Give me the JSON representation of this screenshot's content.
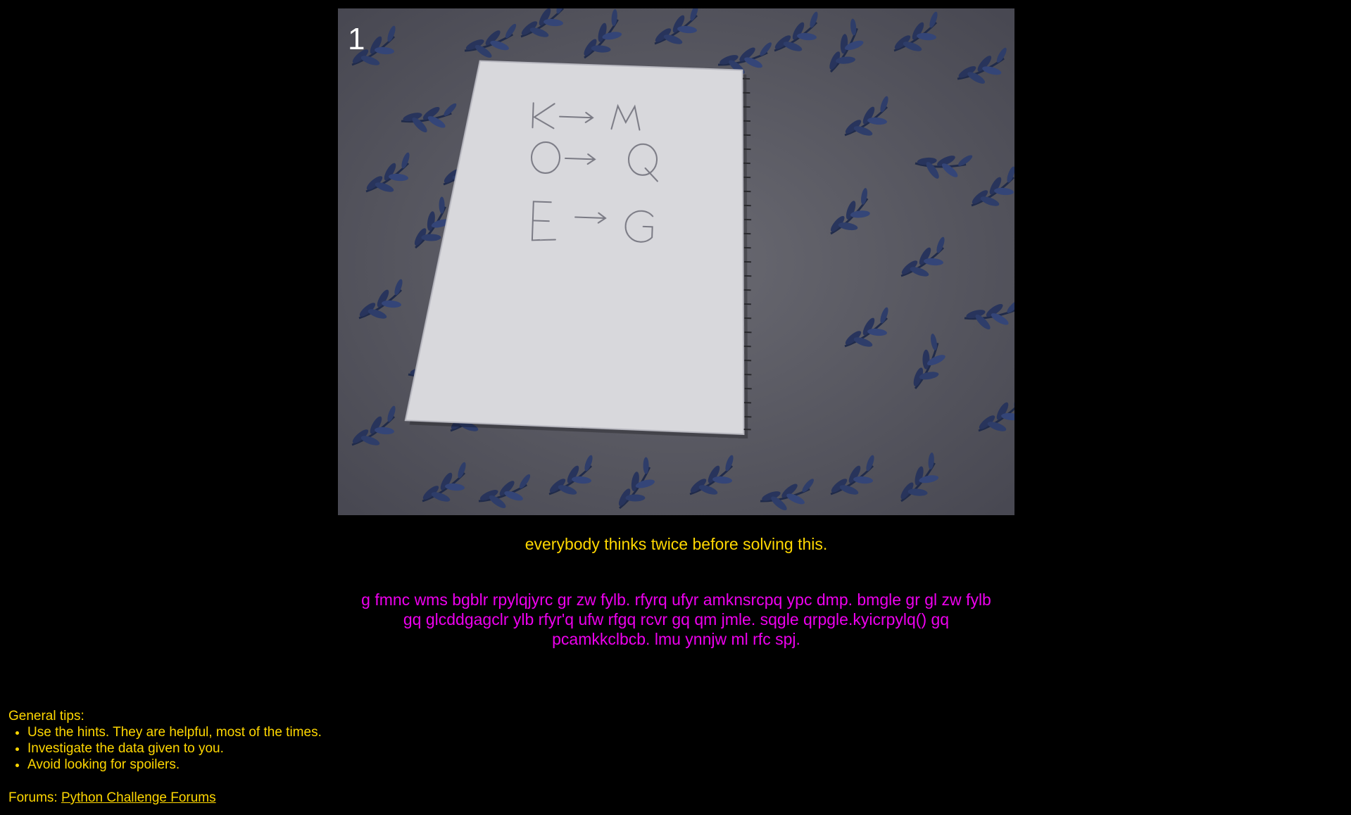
{
  "image": {
    "number_label": "1",
    "notebook_notes": [
      "K→M",
      "O→Q",
      "E→G"
    ]
  },
  "hint": "everybody thinks twice before solving this.",
  "cipher_lines": [
    "g fmnc wms bgblr rpylqjyrc gr zw fylb. rfyrq ufyr amknsrcpq ypc dmp. bmgle gr gl zw fylb",
    "gq glcddgagclr ylb rfyr'q ufw rfgq rcvr gq qm jmle. sqgle qrpgle.kyicrpylq() gq",
    "pcamkkclbcb. lmu ynnjw ml rfc spj."
  ],
  "tips": {
    "title": "General tips:",
    "items": [
      "Use the hints. They are helpful, most of the times.",
      "Investigate the data given to you.",
      "Avoid looking for spoilers."
    ]
  },
  "forums": {
    "label": "Forums:",
    "link_text": "Python Challenge Forums"
  },
  "colors": {
    "background": "#000000",
    "hint_text": "#FFD700",
    "cipher_text": "#EE00EE"
  }
}
